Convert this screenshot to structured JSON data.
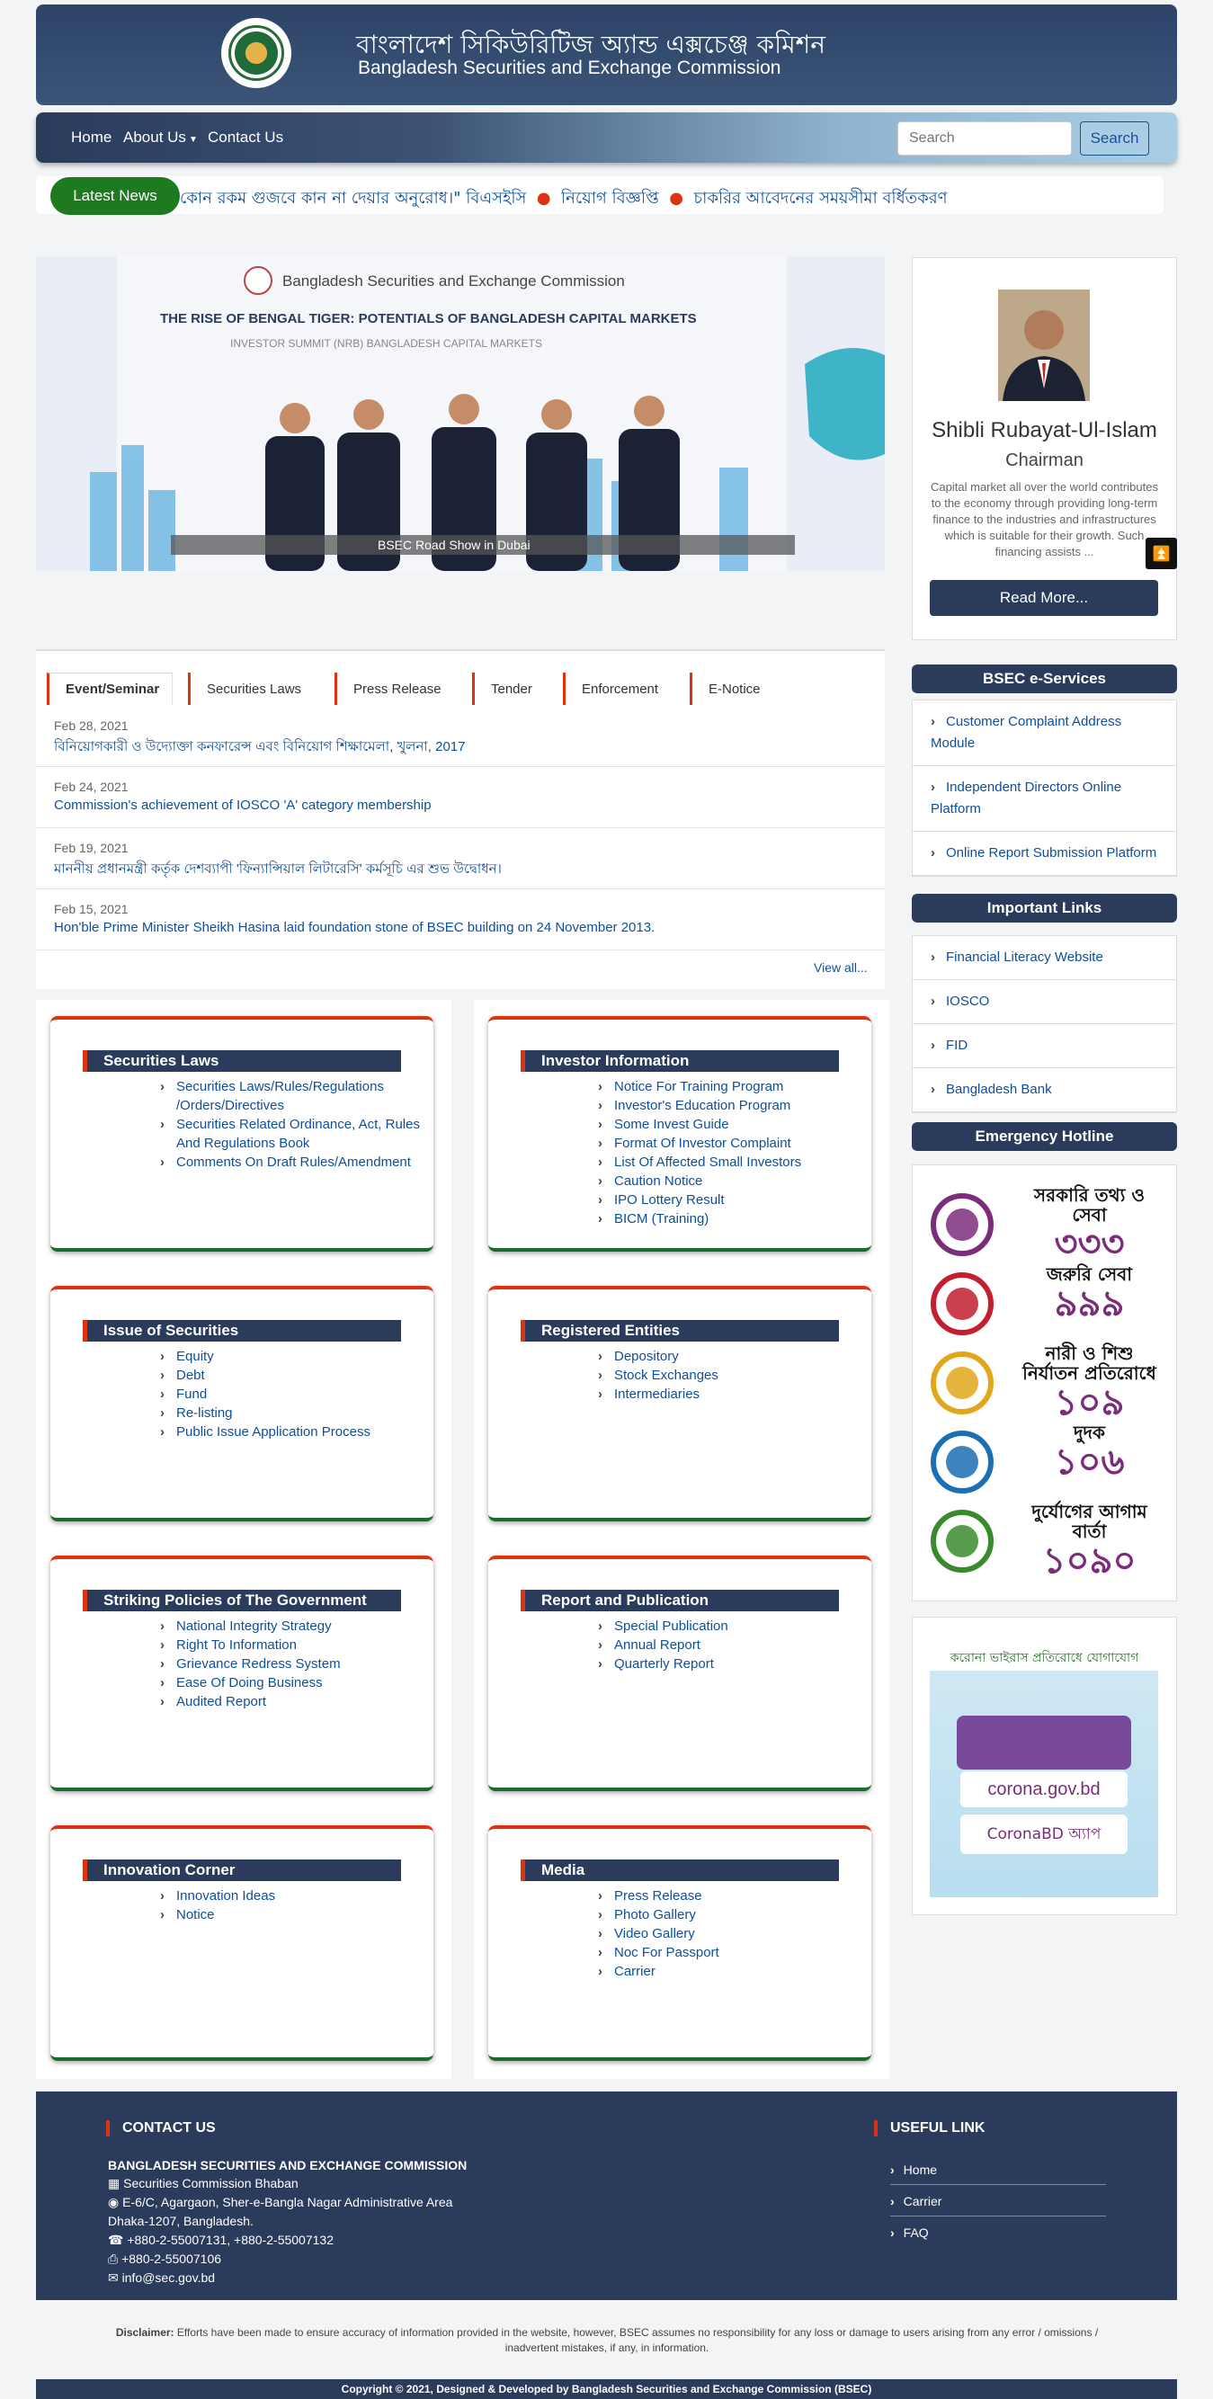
{
  "header": {
    "title_bn": "বাংলাদেশ সিকিউরিটিজ অ্যান্ড এক্সচেঞ্জ কমিশন",
    "title_en": "Bangladesh Securities and Exchange Commission"
  },
  "nav": {
    "items": [
      "Home",
      "About Us",
      "Contact Us"
    ],
    "search_placeholder": "Search",
    "search_button": "Search"
  },
  "ticker": {
    "badge": "Latest News",
    "items": [
      "কোন রকম গুজবে কান না দেয়ার অনুরোধ।\" বিএসইসি",
      "নিয়োগ বিজ্ঞপ্তি",
      "চাকরির আবেদনের সময়সীমা বর্ধিতকরণ"
    ]
  },
  "banner": {
    "org": "Bangladesh Securities and Exchange Commission",
    "headline": "THE RISE OF BENGAL TIGER: POTENTIALS OF BANGLADESH CAPITAL MARKETS",
    "subline": "INVESTOR SUMMIT (NRB) BANGLADESH CAPITAL MARKETS",
    "caption": "BSEC Road Show in Dubai"
  },
  "tabs": [
    "Event/Seminar",
    "Securities Laws",
    "Press Release",
    "Tender",
    "Enforcement",
    "E-Notice"
  ],
  "news": [
    {
      "date": "Feb 28, 2021",
      "title": "বিনিয়োগকারী ও উদ্যোক্তা কনফারেন্স এবং বিনিয়োগ শিক্ষামেলা, খুলনা, 2017"
    },
    {
      "date": "Feb 24, 2021",
      "title": "Commission's achievement of IOSCO 'A' category membership"
    },
    {
      "date": "Feb 19, 2021",
      "title": "মাননীয় প্রধানমন্ত্রী কর্তৃক দেশব্যাপী 'ফিন্যান্সিয়াল লিটারেসি' কর্মসূচি এর শুভ উদ্বোধন।"
    },
    {
      "date": "Feb 15, 2021",
      "title": "Hon'ble Prime Minister Sheikh Hasina laid foundation stone of BSEC building on 24 November 2013."
    }
  ],
  "view_all": "View all...",
  "cards": [
    {
      "title": "Securities Laws",
      "items": [
        "Securities Laws/Rules/Regulations /Orders/Directives",
        "Securities Related Ordinance, Act, Rules And Regulations Book",
        "Comments On Draft Rules/Amendment"
      ]
    },
    {
      "title": "Investor Information",
      "items": [
        "Notice For Training Program",
        "Investor's Education Program",
        "Some Invest Guide",
        "Format Of Investor Complaint",
        "List Of Affected Small Investors",
        "Caution Notice",
        "IPO Lottery Result",
        "BICM (Training)"
      ]
    },
    {
      "title": "Issue of Securities",
      "items": [
        "Equity",
        "Debt",
        "Fund",
        "Re-listing",
        "Public Issue Application Process"
      ]
    },
    {
      "title": "Registered Entities",
      "items": [
        "Depository",
        "Stock Exchanges",
        "Intermediaries"
      ]
    },
    {
      "title": "Striking Policies of The Government",
      "items": [
        "National Integrity Strategy",
        "Right To Information",
        "Grievance Redress System",
        "Ease Of Doing Business",
        "Audited Report"
      ]
    },
    {
      "title": "Report and Publication",
      "items": [
        "Special Publication",
        "Annual Report",
        "Quarterly Report"
      ]
    },
    {
      "title": "Innovation Corner",
      "items": [
        "Innovation Ideas",
        "Notice"
      ]
    },
    {
      "title": "Media",
      "items": [
        "Press Release",
        "Photo Gallery",
        "Video Gallery",
        "Noc For Passport",
        "Carrier"
      ]
    }
  ],
  "profile": {
    "name": "Shibli Rubayat-Ul-Islam",
    "role": "Chairman",
    "desc": "Capital market all over the world contributes to the economy through providing long-term finance to the industries and infrastructures which is suitable for their growth. Such financing assists ...",
    "button": "Read More..."
  },
  "eservices": {
    "title": "BSEC e-Services",
    "items": [
      "Customer Complaint Address Module",
      "Independent Directors Online Platform",
      "Online Report Submission Platform"
    ]
  },
  "important_links": {
    "title": "Important Links",
    "items": [
      "Financial Literacy Website",
      "IOSCO",
      "FID",
      "Bangladesh Bank"
    ]
  },
  "hotline": {
    "title": "Emergency Hotline",
    "rows": [
      {
        "icon": "government-info-icon",
        "label": "সরকারি তথ্য ও সেবা",
        "num": "৩৩৩"
      },
      {
        "icon": "emergency-service-icon",
        "label": "জরুরি সেবা",
        "num": "৯৯৯"
      },
      {
        "icon": "women-child-icon",
        "label": "নারী ও শিশু নির্যাতন প্রতিরোধে",
        "num": "১০৯"
      },
      {
        "icon": "anti-corruption-icon",
        "label": "দুদক",
        "num": "১০৬"
      },
      {
        "icon": "disaster-warning-icon",
        "label": "দুর্যোগের আগাম বার্তা",
        "num": "১০৯০"
      }
    ]
  },
  "corona": {
    "title": "করোনা ভাইরাস প্রতিরোধে যোগাযোগ",
    "site": "corona.gov.bd",
    "app": "CoronaBD অ্যাপ"
  },
  "footer": {
    "contact_title": "CONTACT US",
    "org": "BANGLADESH SECURITIES AND EXCHANGE COMMISSION",
    "lines": [
      "Securities Commission Bhaban",
      "E-6/C, Agargaon, Sher-e-Bangla Nagar Administrative Area",
      "Dhaka-1207, Bangladesh.",
      "+880-2-55007131, +880-2-55007132",
      "+880-2-55007106",
      "info@sec.gov.bd"
    ],
    "useful_title": "USEFUL LINK",
    "useful": [
      "Home",
      "Carrier",
      "FAQ"
    ]
  },
  "disclaimer_label": "Disclaimer:",
  "disclaimer": "Efforts have been made to ensure accuracy of information provided in the website, however, BSEC assumes no responsibility for any loss or damage to users arising from any error / omissions / inadvertent mistakes, if any, in information.",
  "copyright": "Copyright © 2021, Designed & Developed by Bangladesh Securities and Exchange Commission (BSEC)"
}
